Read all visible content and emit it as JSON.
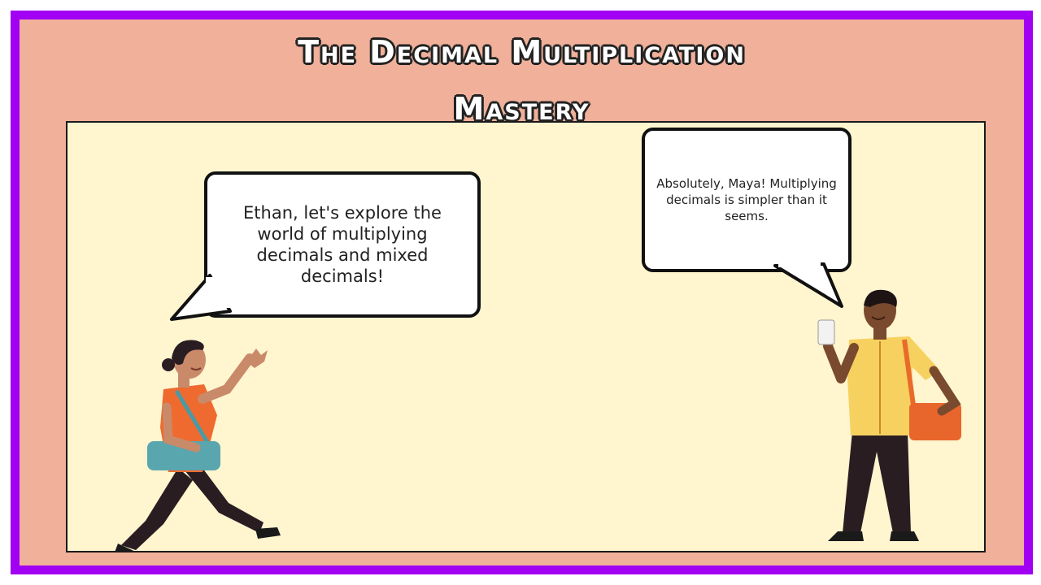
{
  "title": {
    "line1": "The Decimal Multiplication",
    "line2": "Mastery"
  },
  "dialogue": {
    "left_speech": "Ethan, let's explore the world of multiplying decimals and mixed decimals!",
    "right_speech": "Absolutely, Maya! Multiplying decimals is simpler than it seems."
  },
  "colors": {
    "border": "#a100f2",
    "background": "#f0b09a",
    "panel": "#fff5cf"
  },
  "icons": {
    "left_character": "woman-waving-with-bag",
    "right_character": "man-holding-phone-with-bag"
  }
}
